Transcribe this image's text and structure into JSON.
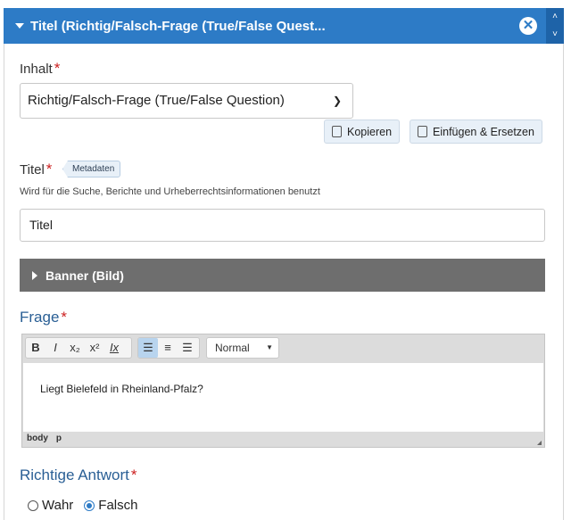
{
  "header": {
    "title": "Titel (Richtig/Falsch-Frage (True/False Quest...",
    "close_icon": "close-icon",
    "scroll_up_icon": "chevron-up-icon",
    "scroll_down_icon": "chevron-down-icon"
  },
  "content": {
    "label": "Inhalt",
    "required": "*",
    "selected": "Richtig/Falsch-Frage (True/False Question)",
    "copy_button": "Kopieren",
    "paste_button": "Einfügen & Ersetzen"
  },
  "title_field": {
    "label": "Titel",
    "required": "*",
    "badge": "Metadaten",
    "hint": "Wird für die Suche, Berichte und Urheberrechtsinformationen benutzt",
    "value": "Titel"
  },
  "banner": {
    "label": "Banner (Bild)"
  },
  "question": {
    "label": "Frage",
    "required": "*",
    "toolbar": {
      "bold": "B",
      "italic": "I",
      "subscript": "x₂",
      "superscript": "x²",
      "remove_format": "Ix",
      "format_selected": "Normal"
    },
    "text": "Liegt Bielefeld in Rheinland-Pfalz?",
    "path": [
      "body",
      "p"
    ]
  },
  "answer": {
    "label": "Richtige Antwort",
    "required": "*",
    "options": [
      "Wahr",
      "Falsch"
    ],
    "selected": "Falsch"
  },
  "colors": {
    "accent": "#2d7bc6",
    "required": "#cc1f1f",
    "section_label": "#2a5f95"
  }
}
